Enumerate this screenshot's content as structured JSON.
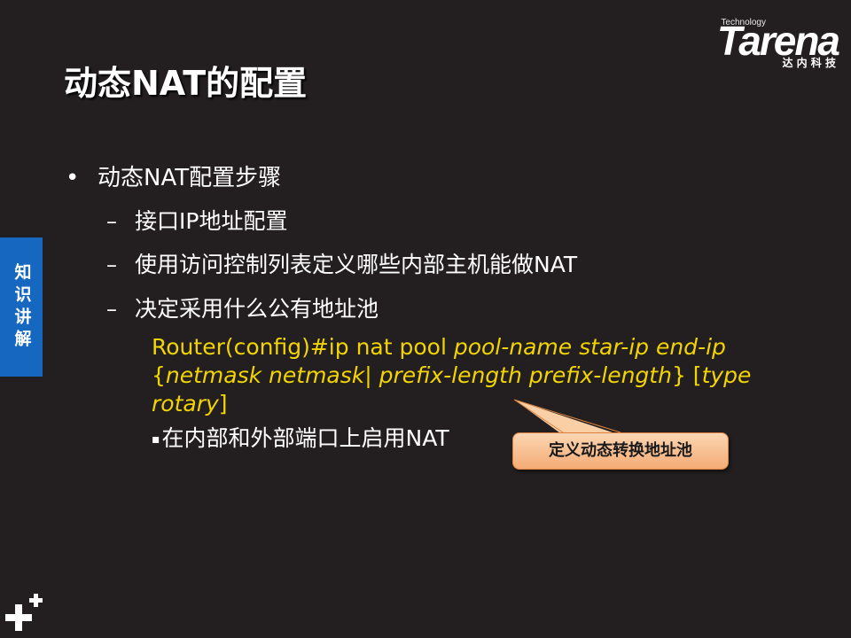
{
  "logo": {
    "technology": "Technology",
    "wordmark": "Tarena",
    "subtitle": "达 内 科 技"
  },
  "side_tab": {
    "label": "知识讲解"
  },
  "title": "动态NAT的配置",
  "bullet": {
    "marker": "•",
    "text": "动态NAT配置步骤",
    "sub_items": [
      {
        "marker": "–",
        "text": "接口IP地址配置"
      },
      {
        "marker": "–",
        "text": "使用访问控制列表定义哪些内部主机能做NAT"
      },
      {
        "marker": "–",
        "text": "决定采用什么公有地址池"
      }
    ]
  },
  "command": {
    "prefix": "Router(config)#ip nat pool ",
    "pool_args": "pool-name star-ip end-ip",
    "brace_open": "{",
    "netmask_arg": "netmask netmask",
    "pipe": "| ",
    "prefix_arg": "prefix-length prefix-length",
    "brace_close": "} [",
    "type_word": "type",
    "rotary_word": "rotary",
    "bracket_close": "]"
  },
  "enable_line": {
    "marker": "▪",
    "text": "在内部和外部端口上启用NAT"
  },
  "callout": {
    "text": "定义动态转换地址池"
  },
  "colors": {
    "background": "#231f20",
    "command_yellow": "#f2d400",
    "tab_blue": "#1667c0",
    "callout_fill": "#f7b98a"
  }
}
